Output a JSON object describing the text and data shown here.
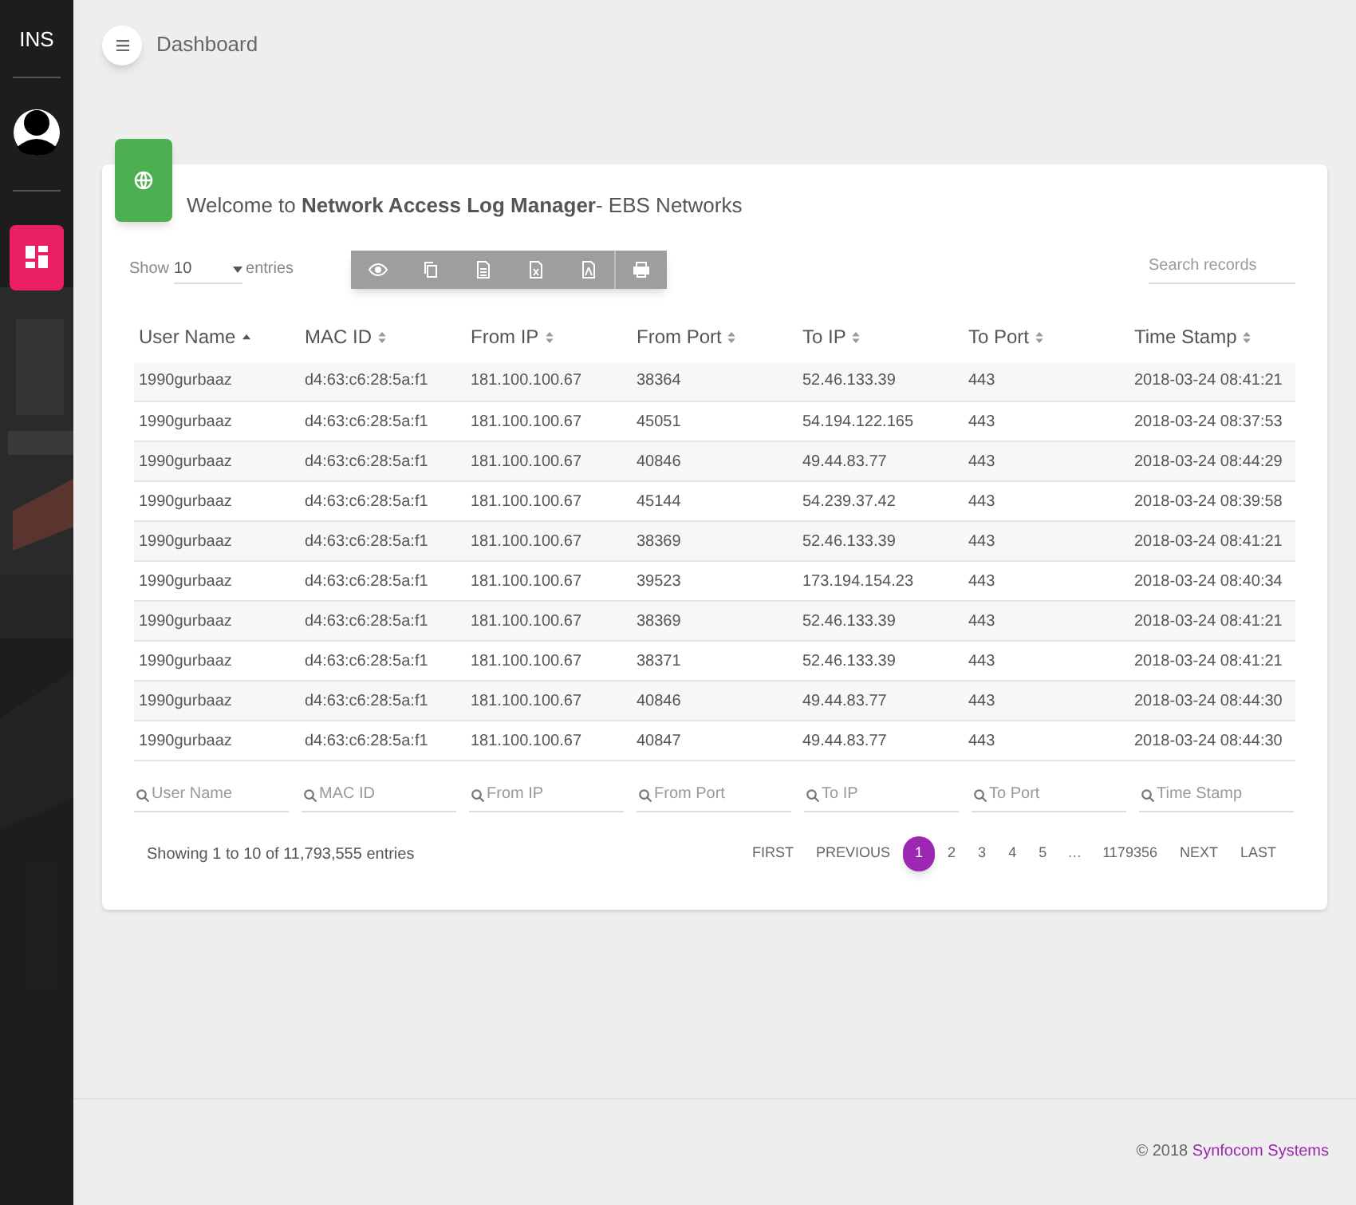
{
  "sidebar": {
    "brand": "INS"
  },
  "topbar": {
    "title": "Dashboard"
  },
  "card": {
    "welcome": "Welcome to **Network Access Log Manager**- EBS Networks",
    "length": {
      "prefix": "Show",
      "value": "10",
      "suffix": "entries"
    },
    "search": {
      "placeholder": "Search records"
    },
    "table": {
      "columns": [
        {
          "label": "User Name",
          "sorted": true
        },
        {
          "label": "MAC ID",
          "sorted": false
        },
        {
          "label": "From IP",
          "sorted": false
        },
        {
          "label": "From Port",
          "sorted": false
        },
        {
          "label": "To IP",
          "sorted": false
        },
        {
          "label": "To Port",
          "sorted": false
        },
        {
          "label": "Time Stamp",
          "sorted": false
        }
      ],
      "rows": [
        [
          "1990gurbaaz",
          "d4:63:c6:28:5a:f1",
          "181.100.100.67",
          "38364",
          "52.46.133.39",
          "443",
          "2018-03-24 08:41:21"
        ],
        [
          "1990gurbaaz",
          "d4:63:c6:28:5a:f1",
          "181.100.100.67",
          "45051",
          "54.194.122.165",
          "443",
          "2018-03-24 08:37:53"
        ],
        [
          "1990gurbaaz",
          "d4:63:c6:28:5a:f1",
          "181.100.100.67",
          "40846",
          "49.44.83.77",
          "443",
          "2018-03-24 08:44:29"
        ],
        [
          "1990gurbaaz",
          "d4:63:c6:28:5a:f1",
          "181.100.100.67",
          "45144",
          "54.239.37.42",
          "443",
          "2018-03-24 08:39:58"
        ],
        [
          "1990gurbaaz",
          "d4:63:c6:28:5a:f1",
          "181.100.100.67",
          "38369",
          "52.46.133.39",
          "443",
          "2018-03-24 08:41:21"
        ],
        [
          "1990gurbaaz",
          "d4:63:c6:28:5a:f1",
          "181.100.100.67",
          "39523",
          "173.194.154.23",
          "443",
          "2018-03-24 08:40:34"
        ],
        [
          "1990gurbaaz",
          "d4:63:c6:28:5a:f1",
          "181.100.100.67",
          "38369",
          "52.46.133.39",
          "443",
          "2018-03-24 08:41:21"
        ],
        [
          "1990gurbaaz",
          "d4:63:c6:28:5a:f1",
          "181.100.100.67",
          "38371",
          "52.46.133.39",
          "443",
          "2018-03-24 08:41:21"
        ],
        [
          "1990gurbaaz",
          "d4:63:c6:28:5a:f1",
          "181.100.100.67",
          "40846",
          "49.44.83.77",
          "443",
          "2018-03-24 08:44:30"
        ],
        [
          "1990gurbaaz",
          "d4:63:c6:28:5a:f1",
          "181.100.100.67",
          "40847",
          "49.44.83.77",
          "443",
          "2018-03-24 08:44:30"
        ]
      ],
      "filters": [
        {
          "placeholder": "User Name"
        },
        {
          "placeholder": "MAC ID"
        },
        {
          "placeholder": "From IP"
        },
        {
          "placeholder": "From Port"
        },
        {
          "placeholder": "To IP"
        },
        {
          "placeholder": "To Port"
        },
        {
          "placeholder": "Time Stamp"
        }
      ]
    },
    "info": "Showing 1 to 10 of 11,793,555 entries",
    "pagination": [
      {
        "label": "FIRST",
        "kind": "nav"
      },
      {
        "label": "PREVIOUS",
        "kind": "nav"
      },
      {
        "label": "1",
        "kind": "page",
        "selected": true
      },
      {
        "label": "2",
        "kind": "page",
        "selected": false
      },
      {
        "label": "3",
        "kind": "page",
        "selected": false
      },
      {
        "label": "4",
        "kind": "page",
        "selected": false
      },
      {
        "label": "5",
        "kind": "page",
        "selected": false
      },
      {
        "label": "…",
        "kind": "ellipsis"
      },
      {
        "label": "1179356",
        "kind": "page",
        "selected": false
      },
      {
        "label": "NEXT",
        "kind": "nav"
      },
      {
        "label": "LAST",
        "kind": "nav"
      }
    ]
  },
  "footer": {
    "copyright": "© 2018",
    "company": "Synfocom Systems"
  }
}
